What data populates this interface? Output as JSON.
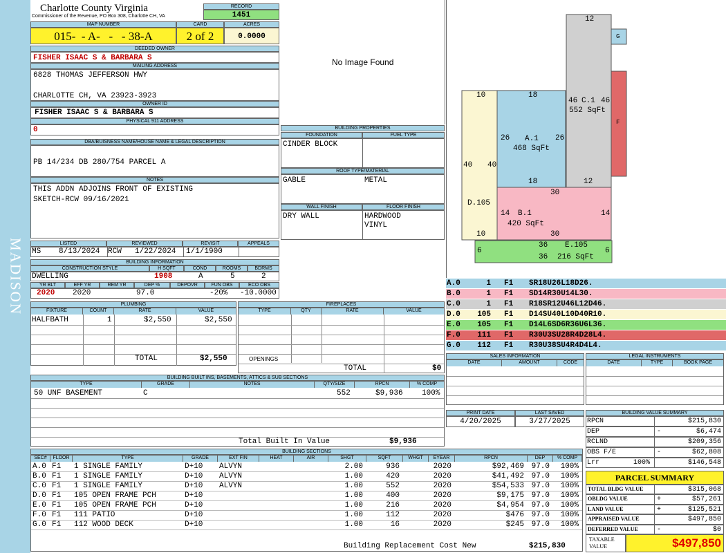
{
  "county": {
    "title": "Charlotte County Virginia",
    "subtitle": "Commissioner of the Revenue, PO Box 308, Charlotte CH, VA"
  },
  "side_label": "MADISON",
  "record": {
    "label": "RECORD",
    "value": "1451"
  },
  "map": {
    "label": "MAP NUMBER",
    "value": "015-  - A-   -   - 38-A"
  },
  "card": {
    "label": "CARD",
    "value": "2 of 2"
  },
  "acres": {
    "label": "ACRES",
    "value": "0.0000"
  },
  "owner": {
    "label": "DEEDED OWNER",
    "value": "FISHER ISAAC S & BARBARA S"
  },
  "mailing": {
    "label": "MAILING ADDRESS",
    "line1": "6828 THOMAS JEFFERSON HWY",
    "line2": "CHARLOTTE CH, VA 23923-3923"
  },
  "owner_id": {
    "label": "OWNER ID",
    "value": "FISHER ISAAC S & BARBARA S"
  },
  "address911": {
    "label": "PHYSICAL 911 ADDRESS",
    "value": "0"
  },
  "legal": {
    "label": "DBA/BUISNESS NAME/HOUSE NAME & LEGAL DESCRIPTION",
    "value": "PB 14/234 DB 280/754 PARCEL A"
  },
  "notes": {
    "label": "NOTES",
    "line1": "THIS ADDN ADJOINS FRONT OF EXISTING",
    "line2": "SKETCH-RCW 09/16/2021"
  },
  "image": {
    "text": "No Image Found"
  },
  "bldg_props": {
    "label": "BUILDING PROPERTIES",
    "foundation_label": "FOUNDATION",
    "fuel_label": "FUEL TYPE",
    "foundation": "CINDER BLOCK",
    "fuel": "",
    "roof_label": "ROOF TYPE/MATERIAL",
    "roof_type": "GABLE",
    "roof_material": "METAL",
    "wall_label": "WALL FINISH",
    "floor_label": "FLOOR FINISH",
    "wall": "DRY WALL",
    "floor1": "HARDWOOD",
    "floor2": "VINYL"
  },
  "dates": {
    "listed_label": "LISTED",
    "reviewed_label": "REVIEWED",
    "revisit_label": "REVISIT",
    "appeals_label": "APPEALS",
    "listed_by": "MS",
    "listed": "8/13/2024",
    "reviewed_by": "RCW",
    "reviewed": "1/22/2024",
    "revisit": "1/1/1900",
    "appeals": ""
  },
  "bldg_info": {
    "label": "BUILDING INFORMATION",
    "style_label": "CONSTRUCTION STYLE",
    "hsqft_label": "H SQFT",
    "cond_label": "COND",
    "rooms_label": "ROOMS",
    "bdrms_label": "BDRMS",
    "style": "DWELLING",
    "hsqft": "1908",
    "cond": "A",
    "rooms": "5",
    "bdrms": "2",
    "yrblt_label": "YR BLT",
    "effyr_label": "EFF YR",
    "remyr_label": "REM YR",
    "dep_label": "DEP %",
    "depovr_label": "DEPOVR",
    "funobs_label": "FUN OBS",
    "ecoobs_label": "ECO OBS",
    "yrblt": "2020",
    "effyr": "2020",
    "remyr": "",
    "dep": "97.0",
    "depovr": "",
    "funobs": "-20%",
    "ecoobs": "-10.0000"
  },
  "plumbing": {
    "label": "PLUMBING",
    "headers": [
      "FIXTURE",
      "COUNT",
      "RATE",
      "VALUE"
    ],
    "rows": [
      [
        "HALFBATH",
        "1",
        "$2,550",
        "$2,550"
      ]
    ],
    "total_label": "TOTAL",
    "total": "$2,550"
  },
  "fireplaces": {
    "label": "FIREPLACES",
    "headers": [
      "TYPE",
      "QTY",
      "RATE",
      "VALUE"
    ],
    "openings_label": "OPENINGS",
    "total_label": "TOTAL",
    "total": "$0"
  },
  "builtins": {
    "label": "BUILDING BUILT INS, BASEMENTS, ATTICS & SUB SECTIONS",
    "headers": [
      "TYPE",
      "GRADE",
      "NOTES",
      "QTY/SIZE",
      "RPCN",
      "% COMP"
    ],
    "rows": [
      [
        "50 UNF BASEMENT",
        "C",
        "",
        "552",
        "$9,936",
        "100%"
      ]
    ],
    "total_label": "Total Built In Value",
    "total": "$9,936"
  },
  "sections": {
    "label": "BUILDING SECTIONS",
    "headers": [
      "SEC#",
      "FLOOR",
      "TYPE",
      "GRADE",
      "EXT FIN",
      "HEAT",
      "AIR",
      "SHGT",
      "SQFT",
      "WHGT",
      "EYEAR",
      "RPCN",
      "DEP",
      "% COMP"
    ],
    "rows": [
      [
        "A.0",
        "F1",
        "1 SINGLE FAMILY",
        "D+10",
        "ALVYN",
        "",
        "",
        "2.00",
        "936",
        "",
        "2020",
        "$92,469",
        "97.0",
        "100%"
      ],
      [
        "B.0",
        "F1",
        "1 SINGLE FAMILY",
        "D+10",
        "ALVYN",
        "",
        "",
        "1.00",
        "420",
        "",
        "2020",
        "$41,492",
        "97.0",
        "100%"
      ],
      [
        "C.0",
        "F1",
        "1 SINGLE FAMILY",
        "D+10",
        "ALVYN",
        "",
        "",
        "1.00",
        "552",
        "",
        "2020",
        "$54,533",
        "97.0",
        "100%"
      ],
      [
        "D.0",
        "F1",
        "105 OPEN FRAME PCH",
        "D+10",
        "",
        "",
        "",
        "1.00",
        "400",
        "",
        "2020",
        "$9,175",
        "97.0",
        "100%"
      ],
      [
        "E.0",
        "F1",
        "105 OPEN FRAME PCH",
        "D+10",
        "",
        "",
        "",
        "1.00",
        "216",
        "",
        "2020",
        "$4,954",
        "97.0",
        "100%"
      ],
      [
        "F.0",
        "F1",
        "111 PATIO",
        "D+10",
        "",
        "",
        "",
        "1.00",
        "112",
        "",
        "2020",
        "$476",
        "97.0",
        "100%"
      ],
      [
        "G.0",
        "F1",
        "112 WOOD DECK",
        "D+10",
        "",
        "",
        "",
        "1.00",
        "16",
        "",
        "2020",
        "$245",
        "97.0",
        "100%"
      ]
    ],
    "total_label": "Building Replacement Cost New",
    "total": "$215,830"
  },
  "sketch": {
    "labels": [
      {
        "id": "a",
        "name": "A.1",
        "area": "468 SqFt"
      },
      {
        "id": "b",
        "name": "B.1",
        "area": "420 SqFt"
      },
      {
        "id": "c",
        "name": "C.1",
        "area": "552 SqFt"
      },
      {
        "id": "d",
        "name": "D.105"
      },
      {
        "id": "e",
        "name": "E.105",
        "area": "216 SqFt"
      },
      {
        "id": "f",
        "name": "F"
      },
      {
        "id": "g",
        "name": "G"
      }
    ],
    "dims": [
      "12",
      "10",
      "18",
      "46",
      "46",
      "26",
      "26",
      "40",
      "40",
      "18",
      "12",
      "30",
      "14",
      "14",
      "10",
      "30",
      "6",
      "36",
      "36",
      "6"
    ]
  },
  "sketch_legend": [
    {
      "sec": "A.0",
      "code": "1",
      "floor": "F1",
      "path": "SR18U26L18D26.",
      "color": "#a8d4e6"
    },
    {
      "sec": "B.0",
      "code": "1",
      "floor": "F1",
      "path": "SD14R30U14L30.",
      "color": "#f8b8c4"
    },
    {
      "sec": "C.0",
      "code": "1",
      "floor": "F1",
      "path": "R18SR12U46L12D46.",
      "color": "#d0d0d0"
    },
    {
      "sec": "D.0",
      "code": "105",
      "floor": "F1",
      "path": "D14SU40L10D40R10.",
      "color": "#fbf6d2"
    },
    {
      "sec": "E.0",
      "code": "105",
      "floor": "F1",
      "path": "D14L6SD6R36U6L36.",
      "color": "#90e080"
    },
    {
      "sec": "F.0",
      "code": "111",
      "floor": "F1",
      "path": "R30U3SU28R4D28L4.",
      "color": "#e06868"
    },
    {
      "sec": "G.0",
      "code": "112",
      "floor": "F1",
      "path": "R30U38SU4R4D4L4.",
      "color": "#a8d4e6"
    }
  ],
  "sales": {
    "label": "SALES INFORMATION",
    "headers": [
      "DATE",
      "AMOUNT",
      "CODE"
    ]
  },
  "legal_inst": {
    "label": "LEGAL INSTRUMENTS",
    "headers": [
      "DATE",
      "TYPE",
      "BOOK PAGE"
    ]
  },
  "print": {
    "print_label": "PRINT DATE",
    "saved_label": "LAST SAVED",
    "print": "4/20/2025",
    "saved": "3/27/2025"
  },
  "value_summary": {
    "label": "BUILDING VALUE SUMMARY",
    "rows": [
      {
        "k": "RPCN",
        "s": "",
        "p": "",
        "v": "$215,830"
      },
      {
        "k": "DEP",
        "s": "",
        "p": "-",
        "v": "$6,474"
      },
      {
        "k": "RCLND",
        "s": "",
        "p": "",
        "v": "$209,356"
      },
      {
        "k": "OBS F/E",
        "s": "",
        "p": "-",
        "v": "$62,808"
      },
      {
        "k": "Lrr",
        "s": "100%",
        "p": "",
        "v": "$146,548"
      }
    ]
  },
  "parcel_summary": {
    "label": "PARCEL SUMMARY",
    "rows": [
      {
        "k": "TOTAL BLDG VALUE",
        "p": "",
        "v": "$315,068"
      },
      {
        "k": "OBLDG VALUE",
        "p": "+",
        "v": "$57,261"
      },
      {
        "k": "LAND VALUE",
        "p": "+",
        "v": "$125,521"
      },
      {
        "k": "APPRAISED VALUE",
        "p": "",
        "v": "$497,850"
      },
      {
        "k": "DEFERRED VALUE",
        "p": "-",
        "v": "$0"
      }
    ],
    "taxable_label": "TAXABLE VALUE",
    "taxable": "$497,850"
  }
}
